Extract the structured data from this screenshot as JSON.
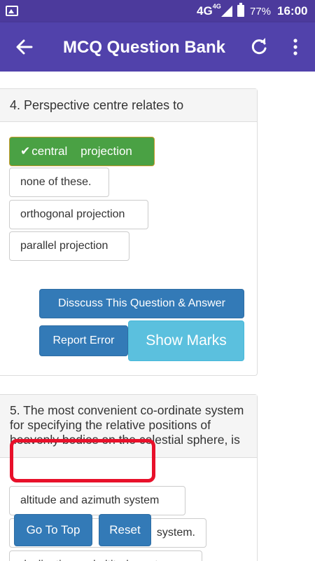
{
  "status_bar": {
    "network": "4G",
    "network_sup": "4G",
    "battery": "77%",
    "time": "16:00"
  },
  "app_bar": {
    "title": "MCQ Question Bank",
    "back_icon": "arrow-left-icon",
    "refresh_icon": "refresh-icon",
    "more_icon": "more-vertical-icon"
  },
  "question4": {
    "text": "4. Perspective centre relates to",
    "options": [
      {
        "label": "central    projection",
        "selected": true
      },
      {
        "label": "none of these."
      },
      {
        "label": "orthogonal projection"
      },
      {
        "label": "parallel projection"
      }
    ],
    "discuss_label": "Disscuss This Question & Answer",
    "report_label": "Report Error",
    "show_marks_label": "Show Marks"
  },
  "question5": {
    "text": "5. The most convenient co-ordinate system for specifying the relative positions of heavenly bodies on the celestial sphere, is",
    "options": [
      {
        "label": "altitude and azimuth system"
      },
      {
        "label": "system."
      },
      {
        "label": "declination and altitude system"
      }
    ]
  },
  "floating": {
    "go_top_label": "Go To Top",
    "reset_label": "Reset"
  },
  "colors": {
    "status_bar": "#4c3a9c",
    "app_bar": "#5142ab",
    "correct": "#4aa144",
    "primary_button": "#337ab7",
    "info_button": "#5bc0de",
    "highlight_border": "#e8102a"
  }
}
